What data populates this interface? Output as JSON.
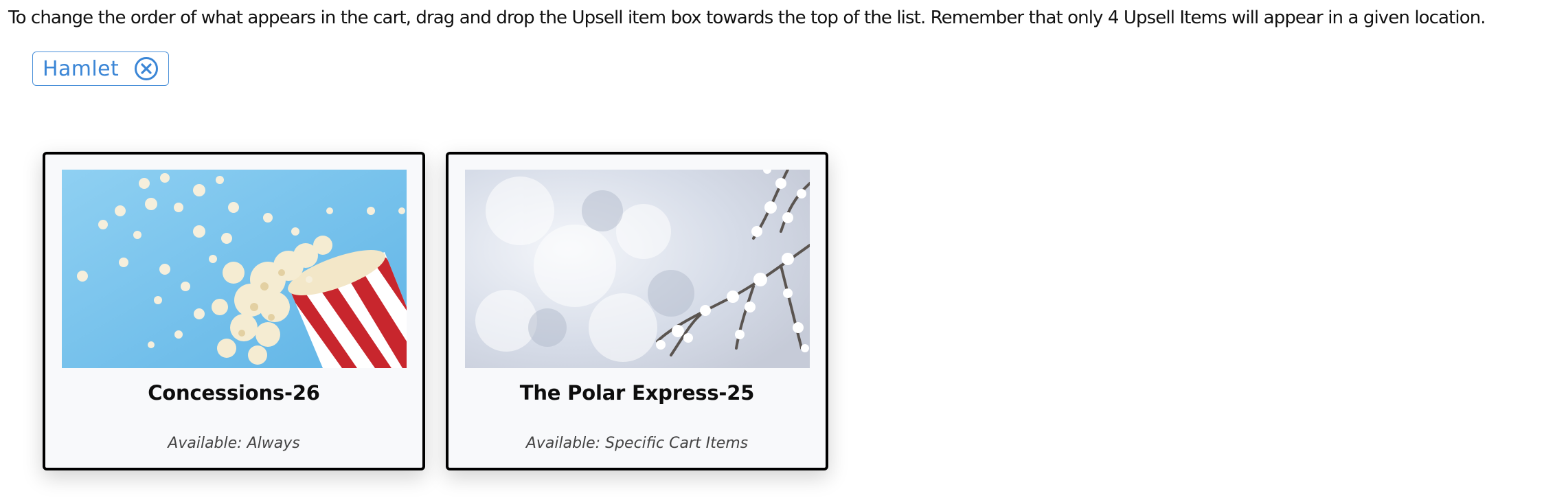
{
  "instructions": "To change the order of what appears in the cart, drag and drop the Upsell item box towards the top of the list. Remember that only 4 Upsell Items will appear in a given location.",
  "filter_chip": {
    "label": "Hamlet",
    "remove_icon": "circle-x-icon",
    "color": "#3b86d6"
  },
  "upsell_items": [
    {
      "title": "Concessions-26",
      "availability": "Available: Always",
      "image": "popcorn-image"
    },
    {
      "title": "The Polar Express-25",
      "availability": "Available: Specific Cart Items",
      "image": "snowy-branch-image"
    }
  ]
}
